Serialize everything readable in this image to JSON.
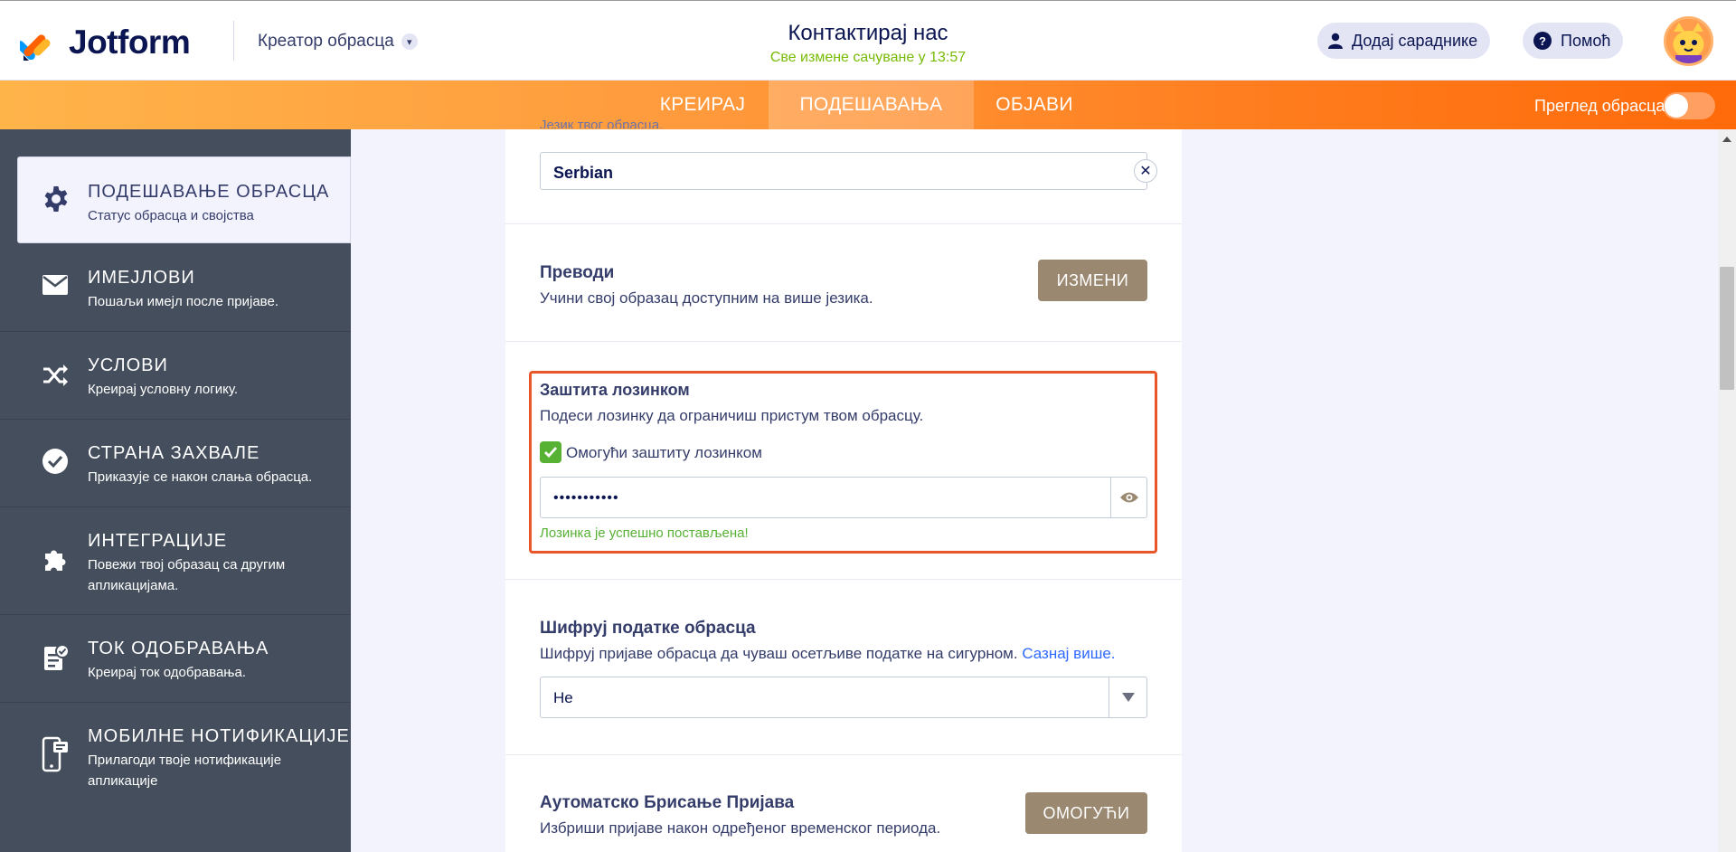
{
  "header": {
    "logo_text": "Jotform",
    "creator_label": "Креатор обрасца",
    "form_title": "Контактирај нас",
    "saved_status": "Све измене сачуване у 13:57",
    "add_collaborators": "Додај сараднике",
    "help": "Помоћ"
  },
  "nav": {
    "tabs": [
      {
        "label": "КРЕИРАЈ",
        "active": false
      },
      {
        "label": "ПОДЕШАВАЊА",
        "active": true
      },
      {
        "label": "ОБЈАВИ",
        "active": false
      }
    ],
    "preview_label": "Преглед обрасца",
    "preview_enabled": false
  },
  "sidebar": {
    "items": [
      {
        "title": "ПОДЕШАВАЊЕ ОБРАСЦА",
        "subtitle": "Статус обрасца и својства",
        "icon": "gear-icon",
        "active": true
      },
      {
        "title": "ИМЕЈЛОВИ",
        "subtitle": "Пошаљи имејл после пријаве.",
        "icon": "envelope-icon",
        "active": false
      },
      {
        "title": "УСЛОВИ",
        "subtitle": "Креирај условну логику.",
        "icon": "shuffle-icon",
        "active": false
      },
      {
        "title": "СТРАНА ЗАХВАЛЕ",
        "subtitle": "Приказује се након слања обрасца.",
        "icon": "check-circle-icon",
        "active": false
      },
      {
        "title": "ИНТЕГРАЦИЈЕ",
        "subtitle": "Повежи твој образац са другим апликацијама.",
        "icon": "puzzle-icon",
        "active": false
      },
      {
        "title": "ТОК ОДОБРАВАЊА",
        "subtitle": "Креирај ток одобравања.",
        "icon": "clipboard-check-icon",
        "active": false
      },
      {
        "title": "МОБИЛНЕ НОТИФИКАЦИЈЕ",
        "subtitle": "Прилагоди твоје нотификације апликације",
        "icon": "mobile-notification-icon",
        "active": false
      }
    ]
  },
  "main": {
    "language_label": "Језик твог обрасца.",
    "language_value": "Serbian",
    "translations": {
      "title": "Преводи",
      "description": "Учини свој образац доступним на више језика.",
      "button": "ИЗМЕНИ"
    },
    "password": {
      "title": "Заштита лозинком",
      "description": "Подеси лозинку да ограничиш пристум твом обрасцу.",
      "checkbox_label": "Омогући заштиту лозинком",
      "checked": true,
      "value": "•••••••••••",
      "success": "Лозинка је успешно постављена!"
    },
    "encrypt": {
      "title": "Шифруј податке обрасца",
      "description": "Шифруј пријаве обрасца да чуваш осетљиве податке на сигурном.",
      "link": "Сазнај више.",
      "value": "Не"
    },
    "auto_delete": {
      "title": "Аутоматско Брисање Пријава",
      "description": "Избриши пријаве након одређеног временског периода.",
      "button": "ОМОГУЋИ"
    }
  },
  "colors": {
    "accent_orange": "#ff7b1c",
    "sidebar_bg": "#454e5c",
    "button_tan": "#9a8870",
    "success_green": "#57b234",
    "highlight_border": "#e8572a"
  }
}
